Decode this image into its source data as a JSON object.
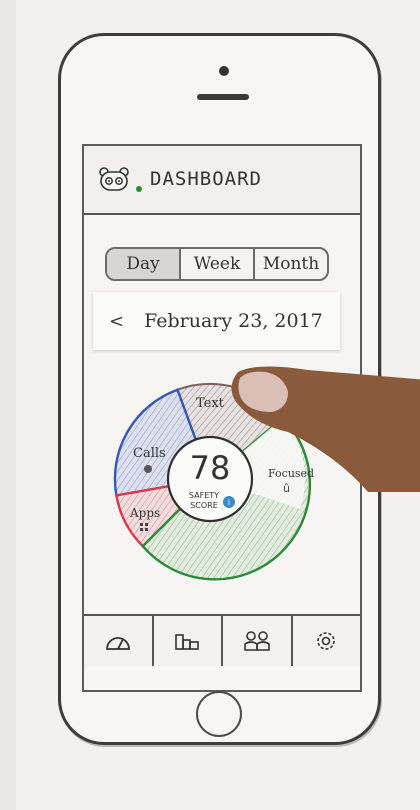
{
  "header": {
    "title": "DASHBOARD"
  },
  "tabs": [
    {
      "label": "Day",
      "active": true
    },
    {
      "label": "Week",
      "active": false
    },
    {
      "label": "Month",
      "active": false
    }
  ],
  "date": {
    "prev_symbol": "<",
    "label": "February 23, 2017"
  },
  "score": {
    "value": "78",
    "line1": "SAFETY",
    "line2": "SCORE",
    "info_icon": "i"
  },
  "segments": [
    {
      "label": "Text",
      "color": "#8a6a6a"
    },
    {
      "label": "Calls",
      "color": "#3557b8"
    },
    {
      "label": "Apps",
      "color": "#d63c4c"
    },
    {
      "label": "Focused",
      "color": "#2d8a3a",
      "icon_text": "û"
    }
  ],
  "bottom_nav": [
    "gauge-icon",
    "bar-chart-icon",
    "people-icon",
    "settings-icon"
  ]
}
